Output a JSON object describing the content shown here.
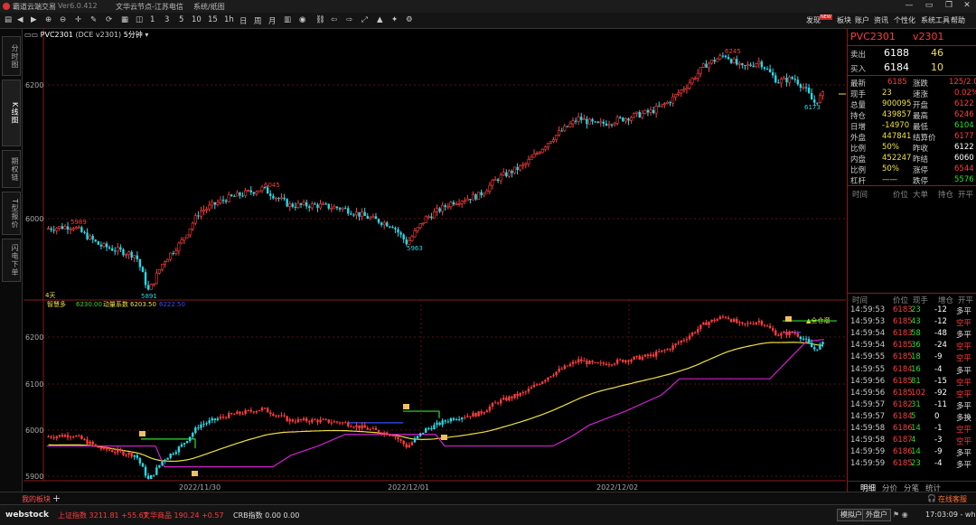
{
  "app": {
    "name": "霸道云端交易",
    "version": "Ver6.0.412",
    "server": "文华云节点-江苏电信",
    "news": "系统/纸图"
  },
  "toolbar": {
    "items": [
      "1",
      "3",
      "5",
      "10",
      "15",
      "1h",
      "日",
      "周",
      "月"
    ],
    "menu": [
      "发现",
      "板块",
      "账户",
      "资讯",
      "个性化",
      "系统工具",
      "帮助"
    ],
    "badge": "NEW"
  },
  "side_tabs": [
    "分时图",
    "K线图",
    "期权链",
    "T型报价",
    "闪电下单"
  ],
  "chart": {
    "symbol": "PVC2301",
    "tag": "(DCE v2301)",
    "period": "5分钟",
    "count_label": "4天",
    "ind_label": "智慧多",
    "ind_v1": "6230.00",
    "ind_l2": "动量系数",
    "ind_v2": "6203.50",
    "ind_v3": "6222.50",
    "upper_ticks": [
      "6200",
      "6000"
    ],
    "lower_ticks": [
      "6200",
      "6100",
      "6000",
      "5900"
    ],
    "x_dates": [
      "2022/11/30",
      "2022/12/01",
      "2022/12/02"
    ],
    "annot": [
      "5989",
      "6045",
      "5963",
      "5891",
      "6245",
      "6173"
    ],
    "marker": "▲全仓溜"
  },
  "quote": {
    "code": "PVC2301",
    "contract": "v2301",
    "sell": {
      "label": "卖出",
      "price": "6188",
      "vol": "46"
    },
    "buy": {
      "label": "买入",
      "price": "6184",
      "vol": "10"
    },
    "rows": [
      [
        "最新",
        "6185",
        "涨跌",
        "125/2.06%"
      ],
      [
        "现手",
        "23",
        "速涨",
        "0.02%"
      ],
      [
        "总量",
        "900095",
        "开盘",
        "6122"
      ],
      [
        "持仓",
        "439857",
        "最高",
        "6246"
      ],
      [
        "日增",
        "-14970",
        "最低",
        "6104"
      ],
      [
        "外盘",
        "447841",
        "结算价",
        "6177"
      ],
      [
        "比例",
        "50%",
        "昨收",
        "6122"
      ],
      [
        "内盘",
        "452247",
        "昨结",
        "6060"
      ],
      [
        "比例",
        "50%",
        "涨停",
        "6544"
      ],
      [
        "杠杆",
        "——",
        "跌停",
        "5576"
      ]
    ],
    "hdr1": [
      "时间",
      "价位",
      "大单",
      "持仓",
      "开平"
    ],
    "hdr2": [
      "时间",
      "价位",
      "现手",
      "增仓",
      "开平"
    ],
    "trades": [
      [
        "14:59:53",
        "6183",
        "23",
        "-12",
        "多平"
      ],
      [
        "14:59:53",
        "6185",
        "43",
        "-12",
        "空平"
      ],
      [
        "14:59:54",
        "6183",
        "58",
        "-48",
        "多平"
      ],
      [
        "14:59:54",
        "6185",
        "36",
        "-24",
        "空平"
      ],
      [
        "14:59:55",
        "6185",
        "18",
        "-9",
        "空平"
      ],
      [
        "14:59:55",
        "6184",
        "16",
        "-4",
        "多平"
      ],
      [
        "14:59:56",
        "6185",
        "81",
        "-15",
        "空平"
      ],
      [
        "14:59:56",
        "6185",
        "102",
        "-92",
        "空平"
      ],
      [
        "14:59:57",
        "6182",
        "31",
        "-11",
        "多平"
      ],
      [
        "14:59:57",
        "6184",
        "5",
        "0",
        "多换"
      ],
      [
        "14:59:58",
        "6186",
        "14",
        "-1",
        "空平"
      ],
      [
        "14:59:58",
        "6187",
        "4",
        "-3",
        "空平"
      ],
      [
        "14:59:59",
        "6186",
        "14",
        "-9",
        "多平"
      ],
      [
        "14:59:59",
        "6185",
        "23",
        "-4",
        "多平"
      ]
    ],
    "tabs": [
      "明细",
      "分价",
      "分笔",
      "统计"
    ]
  },
  "bottom": {
    "tab": "我的板块",
    "online": "在线客服"
  },
  "status": {
    "brand": "webstock",
    "sh": "上证指数  3211.81  +55.67",
    "wh": "文华商品  190.24  +0.57",
    "crb": "CRB指数  0.00  0.00",
    "b1": "模拟户",
    "b2": "外盘户",
    "clock": "17:03:09 - wh"
  },
  "colors": {
    "up": "#ff3c3c",
    "down": "#29d8e6",
    "bg": "#000000",
    "accent": "#8b1a1a"
  },
  "chart_data": {
    "type": "candlestick",
    "x": [
      "2022/11/30",
      "2022/12/01",
      "2022/12/02"
    ],
    "y_range_upper": [
      5880,
      6260
    ],
    "y_range_lower": [
      5880,
      6260
    ],
    "annotations": [
      5989,
      6045,
      5963,
      5891,
      6245,
      6173
    ],
    "last": 6185
  }
}
